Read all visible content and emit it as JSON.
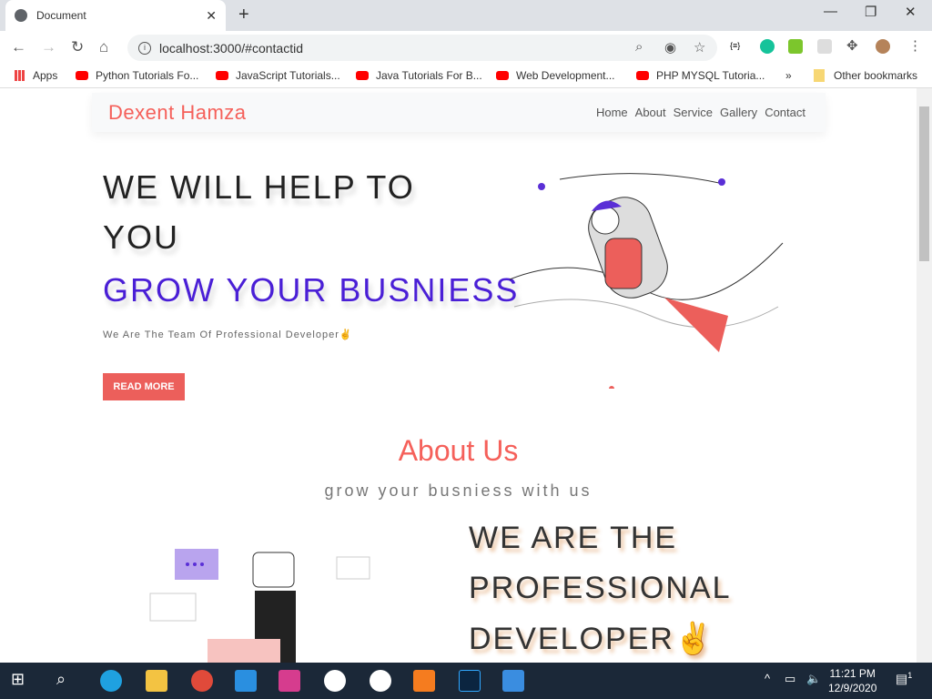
{
  "browser": {
    "tab_title": "Document",
    "url": "localhost:3000/#contactid",
    "bookmarks": [
      "Apps",
      "Python Tutorials Fo...",
      "JavaScript Tutorials...",
      "Java Tutorials For B...",
      "Web Development...",
      "PHP MYSQL Tutoria..."
    ],
    "more": "»",
    "other_bookmarks": "Other bookmarks"
  },
  "site": {
    "brand": "Dexent Hamza",
    "nav": [
      "Home",
      "About",
      "Service",
      "Gallery",
      "Contact"
    ],
    "hero": {
      "line1": "WE WILL HELP TO",
      "line2": "YOU",
      "line3": "GROW YOUR BUSNIESS",
      "subtitle": "We Are The Team Of Professional Developer✌",
      "button": "READ MORE"
    },
    "about": {
      "title": "About Us",
      "subtitle": "grow your busniess with us",
      "line1": "WE ARE THE",
      "line2": "PROFESSIONAL",
      "line3": "DEVELOPER✌"
    }
  },
  "colors": {
    "brand": "#f5605a",
    "accent": "#4a1fd6",
    "button": "#ec5f5b"
  },
  "taskbar": {
    "time": "11:21 PM",
    "date": "12/9/2020",
    "notifications": "1"
  }
}
